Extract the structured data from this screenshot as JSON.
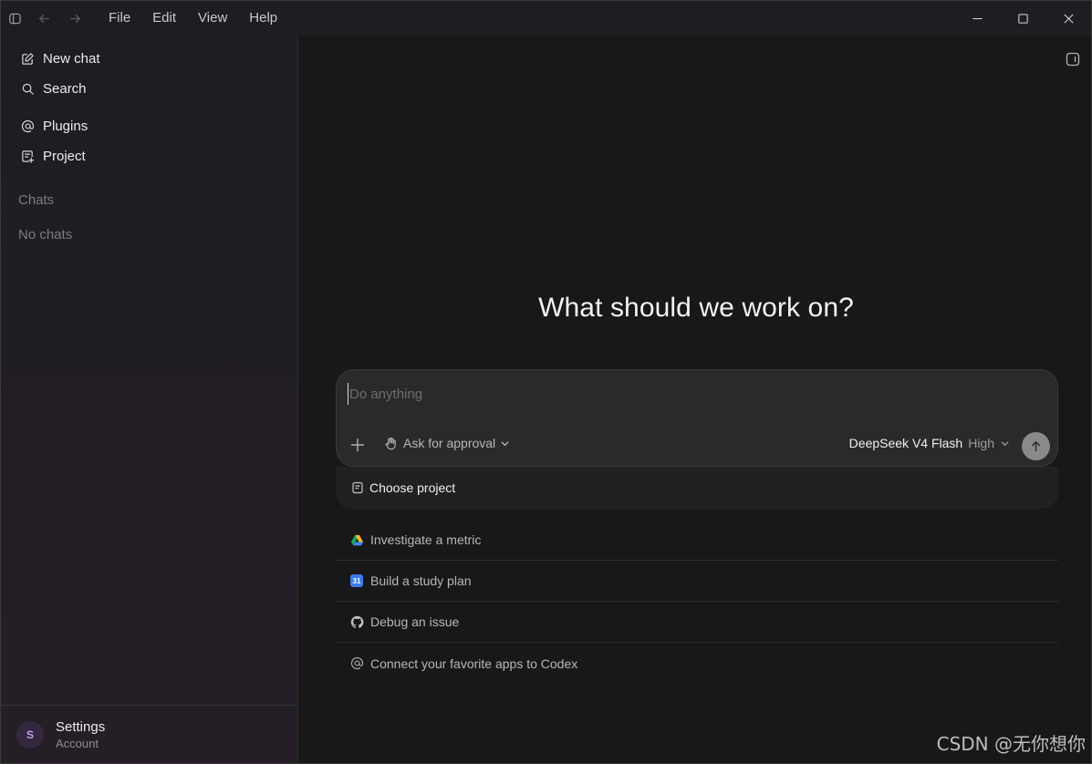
{
  "menu": {
    "file": "File",
    "edit": "Edit",
    "view": "View",
    "help": "Help"
  },
  "sidebar": {
    "items": [
      {
        "label": "New chat",
        "icon": "edit-icon"
      },
      {
        "label": "Search",
        "icon": "search-icon"
      },
      {
        "label": "Plugins",
        "icon": "at-icon"
      },
      {
        "label": "Project",
        "icon": "project-icon"
      }
    ],
    "chats_heading": "Chats",
    "empty_text": "No chats",
    "footer": {
      "avatar_letter": "S",
      "title": "Settings",
      "subtitle": "Account"
    }
  },
  "main": {
    "heading": "What should we work on?",
    "composer": {
      "placeholder": "Do anything",
      "approval_label": "Ask for approval",
      "model_name": "DeepSeek V4 Flash",
      "model_level": "High"
    },
    "project_label": "Choose project",
    "suggestions": [
      {
        "label": "Investigate a metric",
        "icon": "google-drive-icon"
      },
      {
        "label": "Build a study plan",
        "icon": "calendar-icon",
        "badge": "31"
      },
      {
        "label": "Debug an issue",
        "icon": "github-icon"
      },
      {
        "label": "Connect your favorite apps to Codex",
        "icon": "at-icon"
      }
    ]
  },
  "watermark": "CSDN @无你想你",
  "colors": {
    "accent_avatar": "#c49cf0",
    "calendar_blue": "#3b7de8",
    "send_button": "#8a8a8a"
  }
}
